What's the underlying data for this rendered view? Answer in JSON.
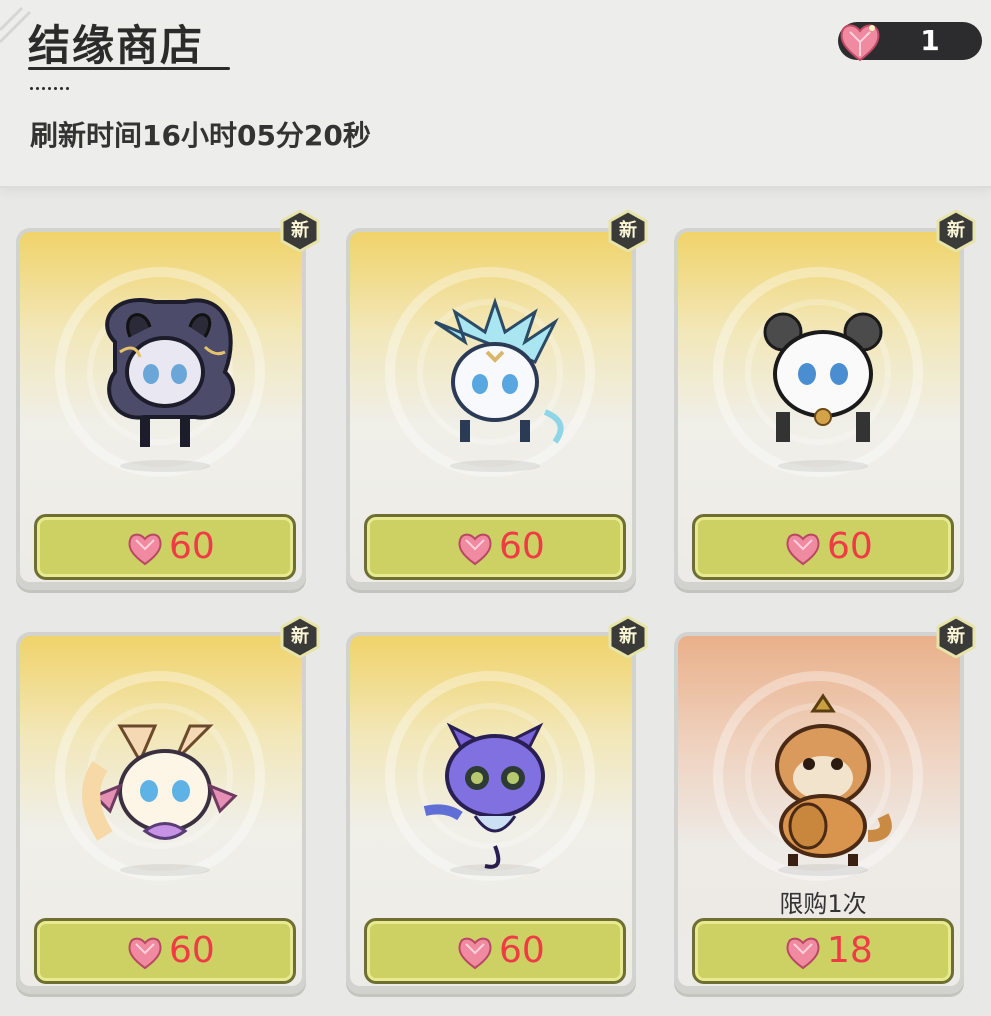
{
  "header": {
    "title": "结缘商店",
    "refresh_text": "刷新时间16小时05分20秒",
    "currency_amount": "1",
    "currency_icon": "heart-crystal-icon"
  },
  "colors": {
    "price_text": "#ee3b46",
    "button_fill": "#cdd063",
    "badge_fill": "#3a3a38"
  },
  "items": [
    {
      "pet": "shadow-fox-pet",
      "badge": "新",
      "price": "60",
      "limit": ""
    },
    {
      "pet": "ice-dragon-pet",
      "badge": "新",
      "price": "60",
      "limit": ""
    },
    {
      "pet": "panda-pet",
      "badge": "新",
      "price": "60",
      "limit": ""
    },
    {
      "pet": "crystal-fox-pet",
      "badge": "新",
      "price": "60",
      "limit": ""
    },
    {
      "pet": "purple-cat-pet",
      "badge": "新",
      "price": "60",
      "limit": ""
    },
    {
      "pet": "red-panda-pet",
      "badge": "新",
      "price": "18",
      "limit": "限购1次"
    }
  ]
}
